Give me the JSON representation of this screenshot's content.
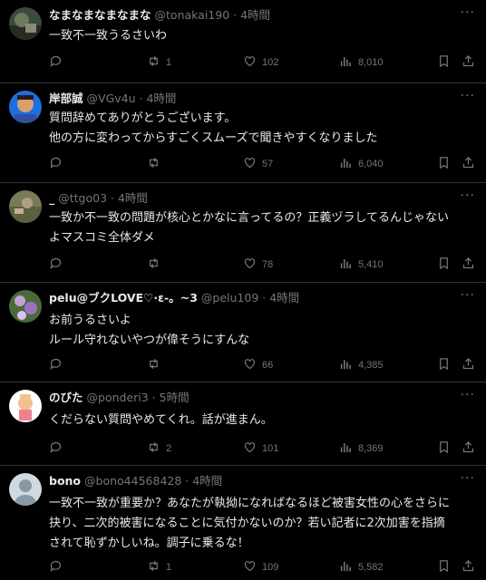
{
  "replies": [
    {
      "name": "なまなまなまなまな",
      "meta": "@tonakai190 · 4時間",
      "text": "一致不一致うるさいわ",
      "retweets": "1",
      "likes": "102",
      "views": "8,010"
    },
    {
      "name": "岸部誠",
      "meta": "@VGv4u · 4時間",
      "text": "質問辞めてありがとうございます。\n他の方に変わってからすごくスムーズで聞きやすくなりました",
      "retweets": "",
      "likes": "57",
      "views": "6,040"
    },
    {
      "name": "_",
      "meta": "@ttgo03 · 4時間",
      "text": "一致か不一致の問題が核心とかなに言ってるの？正義ヅラしてるんじゃない\nよマスコミ全体ダメ",
      "retweets": "",
      "likes": "78",
      "views": "5,410"
    },
    {
      "name": "pelu@ブクLOVE♡·ε-。~3",
      "meta": "@pelu109 · 4時間",
      "text": "お前うるさいよ\nルール守れないやつが偉そうにすんな",
      "retweets": "",
      "likes": "66",
      "views": "4,385"
    },
    {
      "name": "のびた",
      "meta": "@ponderi3 · 5時間",
      "text": "くだらない質問やめてくれ。話が進まん。",
      "retweets": "2",
      "likes": "101",
      "views": "8,369"
    },
    {
      "name": "bono",
      "meta": "@bono44568428 · 4時間",
      "text": "一致不一致が重要か？あなたが執拗になればなるほど被害女性の心をさらに\n抉り、二次的被害になることに気付かないのか？若い記者に2次加害を指摘\nされて恥ずかしいね。調子に乗るな！",
      "retweets": "1",
      "likes": "109",
      "views": "5,582"
    }
  ],
  "icons": {
    "more": "more-icon",
    "reply": "reply-icon",
    "retweet": "retweet-icon",
    "like": "heart-icon",
    "views": "views-icon",
    "bookmark": "bookmark-icon",
    "share": "share-icon"
  },
  "colors": {
    "background": "#000000",
    "text": "#e7e9ea",
    "muted": "#71767b",
    "divider": "#2f3336"
  }
}
